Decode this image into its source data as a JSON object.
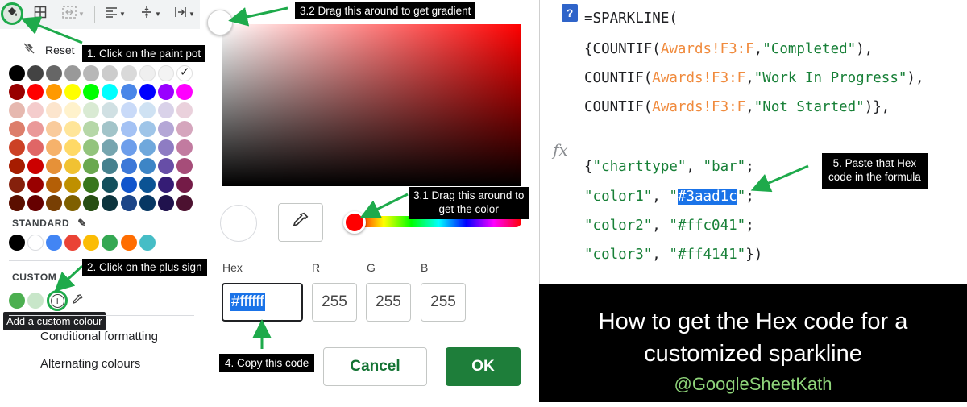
{
  "palette": {
    "reset_label": "Reset",
    "standard_label": "STANDARD",
    "custom_label": "CUSTOM",
    "tooltip": "Add a custom colour",
    "menu": [
      "Conditional formatting",
      "Alternating colours"
    ],
    "swatch_rows": [
      [
        "#000000",
        "#434343",
        "#666666",
        "#999999",
        "#b7b7b7",
        "#cccccc",
        "#d9d9d9",
        "#efefef",
        "#f3f3f3",
        "#ffffff"
      ],
      [
        "#980000",
        "#ff0000",
        "#ff9900",
        "#ffff00",
        "#00ff00",
        "#00ffff",
        "#4a86e8",
        "#0000ff",
        "#9900ff",
        "#ff00ff"
      ],
      [
        "#e6b8af",
        "#f4cccc",
        "#fce5cd",
        "#fff2cc",
        "#d9ead3",
        "#d0e0e3",
        "#c9daf8",
        "#cfe2f3",
        "#d9d2e9",
        "#ead1dc"
      ],
      [
        "#dd7e6b",
        "#ea9999",
        "#f9cb9c",
        "#ffe599",
        "#b6d7a8",
        "#a2c4c9",
        "#a4c2f4",
        "#9fc5e8",
        "#b4a7d6",
        "#d5a6bd"
      ],
      [
        "#cc4125",
        "#e06666",
        "#f6b26b",
        "#ffd966",
        "#93c47d",
        "#76a5af",
        "#6d9eeb",
        "#6fa8dc",
        "#8e7cc3",
        "#c27ba0"
      ],
      [
        "#a61c00",
        "#cc0000",
        "#e69138",
        "#f1c232",
        "#6aa84f",
        "#45818e",
        "#3c78d8",
        "#3d85c6",
        "#674ea7",
        "#a64d79"
      ],
      [
        "#85200c",
        "#990000",
        "#b45f06",
        "#bf9000",
        "#38761d",
        "#134f5c",
        "#1155cc",
        "#0b5394",
        "#351c75",
        "#741b47"
      ],
      [
        "#5b0f00",
        "#660000",
        "#783f04",
        "#7f6000",
        "#274e13",
        "#0c343d",
        "#1c4587",
        "#073763",
        "#20124d",
        "#4c1130"
      ]
    ],
    "standard_colors": [
      "#000000",
      "#ffffff",
      "#4285f4",
      "#ea4335",
      "#fbbc04",
      "#34a853",
      "#ff6d01",
      "#46bdc6"
    ],
    "custom_colors": [
      "#4caf50",
      "#c8e6c9"
    ],
    "check_mark": "✓"
  },
  "picker": {
    "hex_label": "Hex",
    "r_label": "R",
    "g_label": "G",
    "b_label": "B",
    "hex_value": "#ffffff",
    "r_value": "255",
    "g_value": "255",
    "b_value": "255",
    "cancel_label": "Cancel",
    "ok_label": "OK",
    "hue_color": "#ff0000"
  },
  "callouts": {
    "c1": "1. Click on the paint pot",
    "c2": "2. Click on the plus sign",
    "c31_line1": "3.1 Drag this around to",
    "c31_line2": "get the color",
    "c32": "3.2 Drag this around to get gradient",
    "c4": "4. Copy this code",
    "c5_line1": "5. Paste that Hex",
    "c5_line2": "code in the formula"
  },
  "formula": {
    "help": "?",
    "fx": "fx",
    "line1": "=SPARKLINE(",
    "l2_a": "{COUNTIF(",
    "l2_ref": "Awards!F3:F",
    "l2_b": ",",
    "l2_str": "\"Completed\"",
    "l2_c": "),",
    "l3_a": "COUNTIF(",
    "l3_ref": "Awards!F3:F",
    "l3_b": ",",
    "l3_str": "\"Work In Progress\"",
    "l3_c": "),",
    "l4_a": "COUNTIF(",
    "l4_ref": "Awards!F3:F",
    "l4_b": ",",
    "l4_str": "\"Not Started\"",
    "l4_c": ")},",
    "l5_a": "{",
    "l5_s1": "\"charttype\"",
    "l5_b": ", ",
    "l5_s2": "\"bar\"",
    "l5_c": ";",
    "l6_s1": "\"color1\"",
    "l6_b": ", ",
    "l6_q": "\"",
    "l6_hl": "#3aad1c",
    "l6_q2": "\"",
    "l6_c": ";",
    "l7_s1": "\"color2\"",
    "l7_b": ", ",
    "l7_s2": "\"#ffc041\"",
    "l7_c": ";",
    "l8_s1": "\"color3\"",
    "l8_b": ", ",
    "l8_s2": "\"#ff4141\"",
    "l8_c": "})"
  },
  "banner": {
    "title_line1": "How to get the Hex code for a",
    "title_line2": "customized sparkline",
    "handle": "@GoogleSheetKath"
  },
  "accent_green": "#1eaa4b"
}
